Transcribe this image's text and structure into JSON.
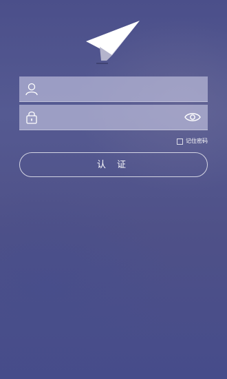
{
  "login": {
    "username_value": "",
    "password_value": "",
    "remember_label": "记住密码",
    "remember_checked": false,
    "submit_label": "认 证"
  },
  "icons": {
    "logo": "paper-plane-icon",
    "username": "user-icon",
    "password": "lock-icon",
    "toggle_visibility": "eye-icon",
    "checkbox": "checkbox-icon"
  },
  "colors": {
    "background": "#4b4f8a",
    "field_fill": "#c8c8e4",
    "text": "#ffffff"
  }
}
